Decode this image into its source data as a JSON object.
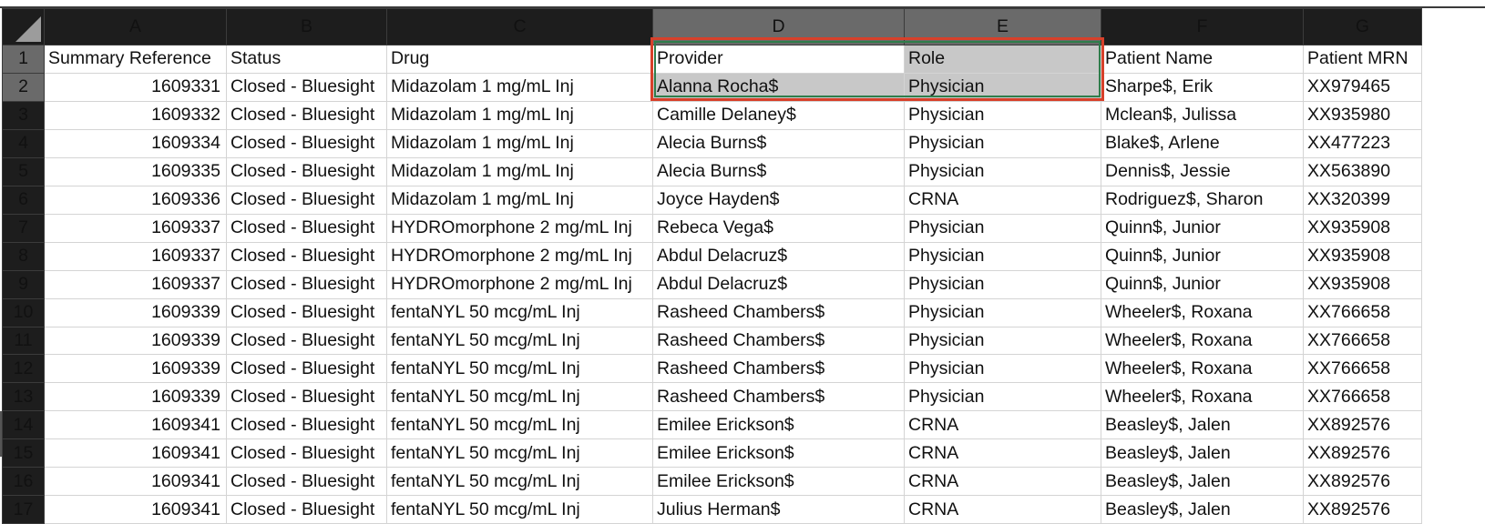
{
  "columns": [
    "A",
    "B",
    "C",
    "D",
    "E",
    "F",
    "G"
  ],
  "selection": {
    "range": "D1:E2",
    "highlight_color": "#d7402a",
    "active_border_color": "#2f7d4b"
  },
  "headers": {
    "a": "Summary Reference",
    "b": "Status",
    "c": "Drug",
    "d": "Provider",
    "e": "Role",
    "f": "Patient Name",
    "g": "Patient MRN"
  },
  "rows": [
    {
      "n": "2",
      "a": "1609331",
      "b": "Closed - Bluesight",
      "c": "Midazolam 1 mg/mL Inj",
      "d": "Alanna Rocha$",
      "e": "Physician",
      "f": "Sharpe$, Erik",
      "g": "XX979465"
    },
    {
      "n": "3",
      "a": "1609332",
      "b": "Closed - Bluesight",
      "c": "Midazolam 1 mg/mL Inj",
      "d": "Camille Delaney$",
      "e": "Physician",
      "f": "Mclean$, Julissa",
      "g": "XX935980"
    },
    {
      "n": "4",
      "a": "1609334",
      "b": "Closed - Bluesight",
      "c": "Midazolam 1 mg/mL Inj",
      "d": "Alecia Burns$",
      "e": "Physician",
      "f": "Blake$, Arlene",
      "g": "XX477223"
    },
    {
      "n": "5",
      "a": "1609335",
      "b": "Closed - Bluesight",
      "c": "Midazolam 1 mg/mL Inj",
      "d": "Alecia Burns$",
      "e": "Physician",
      "f": "Dennis$, Jessie",
      "g": "XX563890"
    },
    {
      "n": "6",
      "a": "1609336",
      "b": "Closed - Bluesight",
      "c": "Midazolam 1 mg/mL Inj",
      "d": "Joyce Hayden$",
      "e": "CRNA",
      "f": "Rodriguez$, Sharon",
      "g": "XX320399"
    },
    {
      "n": "7",
      "a": "1609337",
      "b": "Closed - Bluesight",
      "c": "HYDROmorphone 2 mg/mL Inj",
      "d": "Rebeca Vega$",
      "e": "Physician",
      "f": "Quinn$, Junior",
      "g": "XX935908"
    },
    {
      "n": "8",
      "a": "1609337",
      "b": "Closed - Bluesight",
      "c": "HYDROmorphone 2 mg/mL Inj",
      "d": "Abdul Delacruz$",
      "e": "Physician",
      "f": "Quinn$, Junior",
      "g": "XX935908"
    },
    {
      "n": "9",
      "a": "1609337",
      "b": "Closed - Bluesight",
      "c": "HYDROmorphone 2 mg/mL Inj",
      "d": "Abdul Delacruz$",
      "e": "Physician",
      "f": "Quinn$, Junior",
      "g": "XX935908"
    },
    {
      "n": "10",
      "a": "1609339",
      "b": "Closed - Bluesight",
      "c": "fentaNYL 50 mcg/mL Inj",
      "d": "Rasheed Chambers$",
      "e": "Physician",
      "f": "Wheeler$, Roxana",
      "g": "XX766658"
    },
    {
      "n": "11",
      "a": "1609339",
      "b": "Closed - Bluesight",
      "c": "fentaNYL 50 mcg/mL Inj",
      "d": "Rasheed Chambers$",
      "e": "Physician",
      "f": "Wheeler$, Roxana",
      "g": "XX766658"
    },
    {
      "n": "12",
      "a": "1609339",
      "b": "Closed - Bluesight",
      "c": "fentaNYL 50 mcg/mL Inj",
      "d": "Rasheed Chambers$",
      "e": "Physician",
      "f": "Wheeler$, Roxana",
      "g": "XX766658"
    },
    {
      "n": "13",
      "a": "1609339",
      "b": "Closed - Bluesight",
      "c": "fentaNYL 50 mcg/mL Inj",
      "d": "Rasheed Chambers$",
      "e": "Physician",
      "f": "Wheeler$, Roxana",
      "g": "XX766658"
    },
    {
      "n": "14",
      "a": "1609341",
      "b": "Closed - Bluesight",
      "c": "fentaNYL 50 mcg/mL Inj",
      "d": "Emilee Erickson$",
      "e": "CRNA",
      "f": "Beasley$, Jalen",
      "g": "XX892576"
    },
    {
      "n": "15",
      "a": "1609341",
      "b": "Closed - Bluesight",
      "c": "fentaNYL 50 mcg/mL Inj",
      "d": "Emilee Erickson$",
      "e": "CRNA",
      "f": "Beasley$, Jalen",
      "g": "XX892576"
    },
    {
      "n": "16",
      "a": "1609341",
      "b": "Closed - Bluesight",
      "c": "fentaNYL 50 mcg/mL Inj",
      "d": "Emilee Erickson$",
      "e": "CRNA",
      "f": "Beasley$, Jalen",
      "g": "XX892576"
    },
    {
      "n": "17",
      "a": "1609341",
      "b": "Closed - Bluesight",
      "c": "fentaNYL 50 mcg/mL Inj",
      "d": "Julius Herman$",
      "e": "CRNA",
      "f": "Beasley$, Jalen",
      "g": "XX892576"
    }
  ]
}
